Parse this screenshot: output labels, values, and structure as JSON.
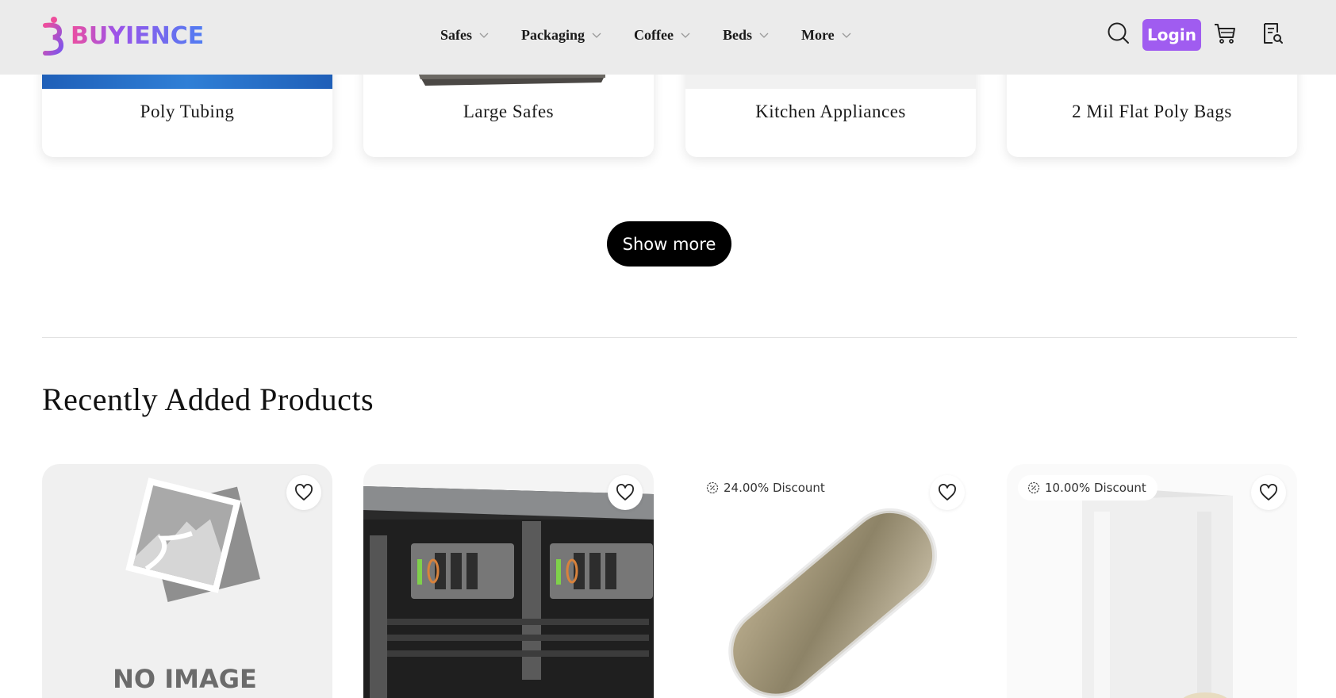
{
  "brand": {
    "name": "BUYIENCE"
  },
  "nav": {
    "items": [
      {
        "label": "Safes"
      },
      {
        "label": "Packaging"
      },
      {
        "label": "Coffee"
      },
      {
        "label": "Beds"
      },
      {
        "label": "More"
      }
    ]
  },
  "header": {
    "login_label": "Login"
  },
  "categories": [
    {
      "label": "Poly Tubing"
    },
    {
      "label": "Large Safes"
    },
    {
      "label": "Kitchen Appliances"
    },
    {
      "label": "2 Mil Flat Poly Bags"
    }
  ],
  "show_more_label": "Show more",
  "recent": {
    "title": "Recently Added Products",
    "products": [
      {
        "placeholder_text": "NO IMAGE",
        "discount": ""
      },
      {
        "discount": ""
      },
      {
        "discount": "24.00% Discount"
      },
      {
        "discount": "10.00% Discount"
      }
    ]
  },
  "colors": {
    "header_bg": "#ebebeb",
    "accent": "#a05cf0",
    "button_dark": "#000000"
  }
}
